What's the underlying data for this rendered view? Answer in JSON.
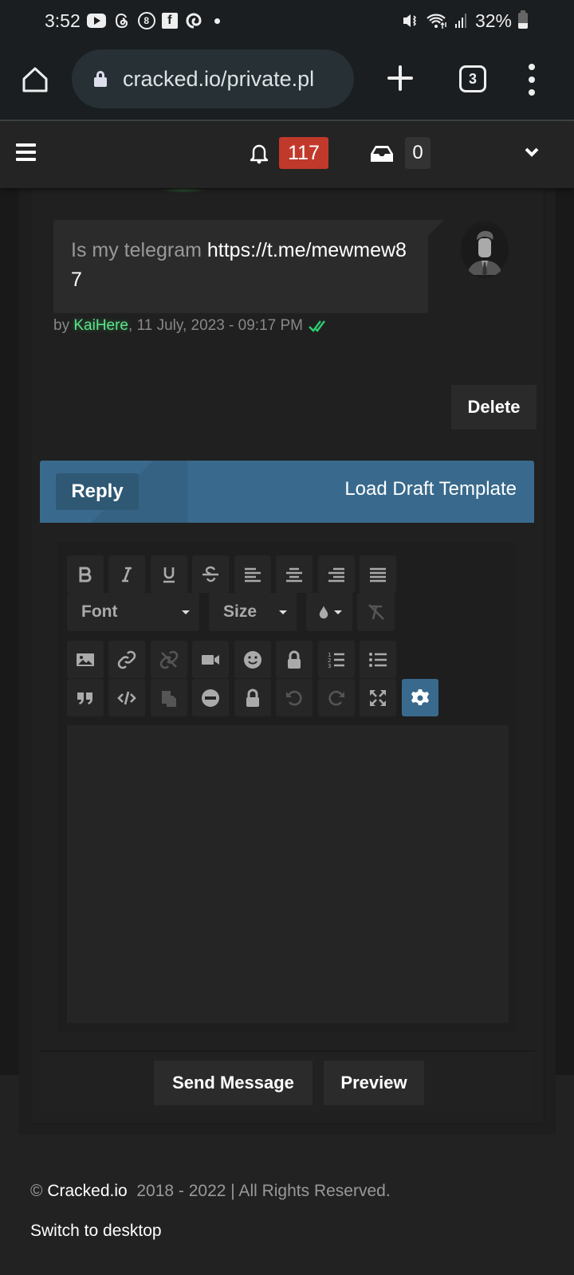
{
  "status_bar": {
    "time": "3:52",
    "notification_icons": [
      "youtube-icon",
      "threads-icon",
      "8ball-icon",
      "facebook-icon",
      "swirl-app-icon",
      "more-dot-icon"
    ],
    "battery_percent": "32%",
    "system_icons": [
      "mute-vibrate-icon",
      "wifi-icon",
      "signal-icon",
      "battery-icon"
    ]
  },
  "browser": {
    "url": "cracked.io/private.pl",
    "tab_count": "3"
  },
  "site_header": {
    "notification_count": "117",
    "inbox_count": "0"
  },
  "message": {
    "prefix": "Is my telegram ",
    "link": "https://t.me/mewmew87",
    "by_label": "by ",
    "author": "KaiHere",
    "timestamp": ", 11 July, 2023 - 09:17 PM",
    "read_status": "read",
    "read_color": "#2ecc71"
  },
  "actions": {
    "delete_label": "Delete"
  },
  "reply": {
    "title": "Reply",
    "draft_template_label": "Load Draft Template",
    "accent_color": "#396a8d"
  },
  "editor": {
    "toolbar_row1": [
      "bold",
      "italic",
      "underline",
      "strikethrough",
      "align-left",
      "align-center",
      "align-right",
      "justify"
    ],
    "font_select": "Font",
    "size_select": "Size",
    "toolbar_row2": [
      "text-color",
      "remove-format"
    ],
    "toolbar_row3": [
      "image",
      "link",
      "unlink",
      "video",
      "emoticon",
      "hide-content",
      "ordered-list",
      "unordered-list"
    ],
    "toolbar_row4": [
      "quote",
      "code",
      "paste",
      "horizontal-rule",
      "lock",
      "undo",
      "redo",
      "maximize",
      "source-settings"
    ],
    "content": ""
  },
  "buttons": {
    "send_label": "Send Message",
    "preview_label": "Preview"
  },
  "footer": {
    "copyright_symbol": "© ",
    "brand": "Cracked.io",
    "copyright_rest": "  2018 - 2022 | All Rights Reserved.",
    "switch_desktop_label": "Switch to desktop"
  }
}
